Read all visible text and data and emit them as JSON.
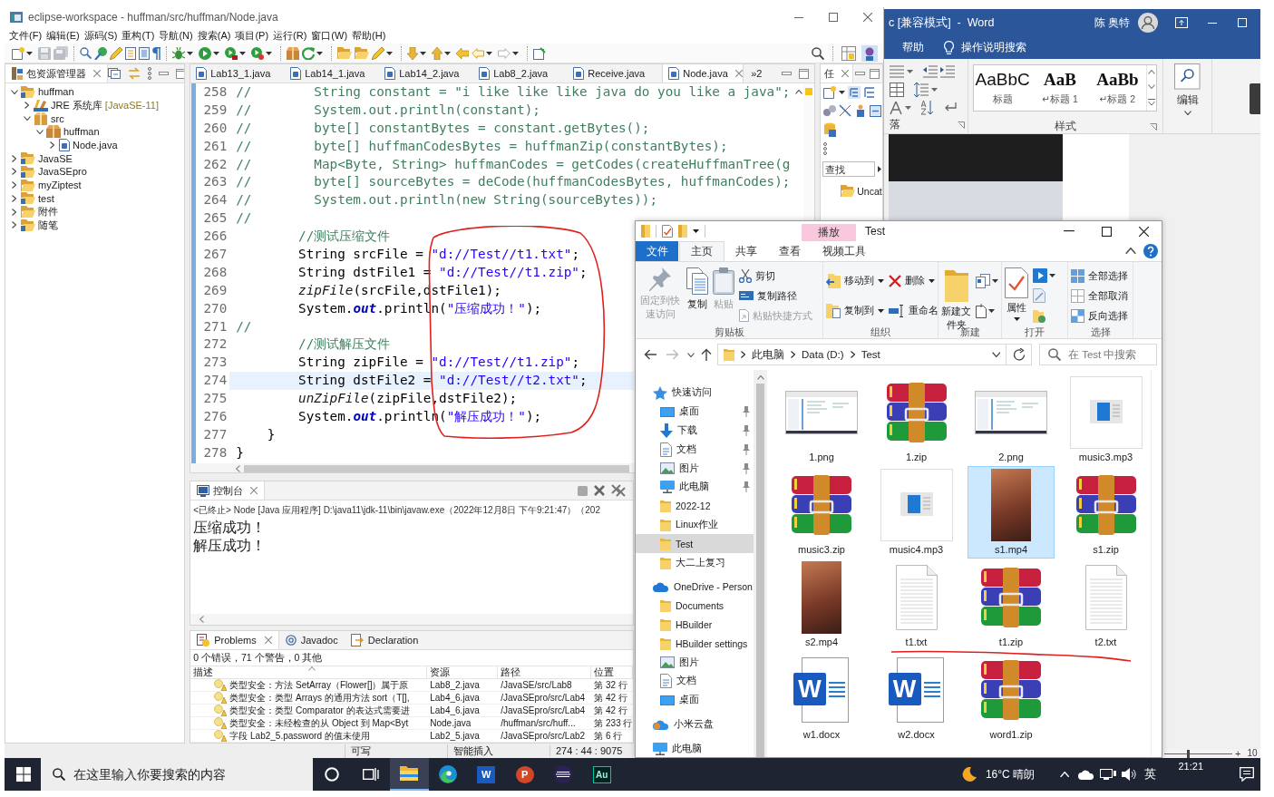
{
  "eclipse": {
    "title": "eclipse-workspace - huffman/src/huffman/Node.java",
    "menu": [
      "文件(F)",
      "编辑(E)",
      "源码(S)",
      "重构(T)",
      "导航(N)",
      "搜索(A)",
      "项目(P)",
      "运行(R)",
      "窗口(W)",
      "帮助(H)"
    ],
    "package_explorer": {
      "title": "包资源管理器",
      "tree": [
        {
          "label": "huffman",
          "kind": "project",
          "expanded": true,
          "children": [
            {
              "label": "JRE 系统库",
              "suffix": "[JavaSE-11]",
              "kind": "library",
              "expanded": false
            },
            {
              "label": "src",
              "kind": "source",
              "expanded": true,
              "children": [
                {
                  "label": "huffman",
                  "kind": "package",
                  "expanded": true,
                  "children": [
                    {
                      "label": "Node.java",
                      "kind": "file",
                      "expanded": false
                    }
                  ]
                }
              ]
            }
          ]
        },
        {
          "label": "JavaSE",
          "kind": "project",
          "expanded": false
        },
        {
          "label": "JavaSEpro",
          "kind": "project",
          "expanded": false
        },
        {
          "label": "myZiptest",
          "kind": "folder",
          "expanded": false
        },
        {
          "label": "test",
          "kind": "project",
          "expanded": false
        },
        {
          "label": "附件",
          "kind": "folder",
          "expanded": false
        },
        {
          "label": "随笔",
          "kind": "project",
          "expanded": false
        }
      ]
    },
    "editor": {
      "tabs": [
        {
          "label": "Lab13_1.java",
          "selected": false
        },
        {
          "label": "Lab14_1.java",
          "selected": false
        },
        {
          "label": "Lab14_2.java",
          "selected": false
        },
        {
          "label": "Lab8_2.java",
          "selected": false
        },
        {
          "label": "Receive.java",
          "selected": false
        },
        {
          "label": "Node.java",
          "selected": true
        }
      ],
      "more": "»2",
      "lines": [
        {
          "number": "258",
          "current": false,
          "tokens": [
            {
              "kind": "comment",
              "text": "//        String constant = \"i like like like java do you like a java\";"
            }
          ]
        },
        {
          "number": "259",
          "current": false,
          "tokens": [
            {
              "kind": "comment",
              "text": "//        System.out.println(constant);"
            }
          ]
        },
        {
          "number": "260",
          "current": false,
          "tokens": [
            {
              "kind": "comment",
              "text": "//        byte[] constantBytes = constant.getBytes();"
            }
          ]
        },
        {
          "number": "261",
          "current": false,
          "tokens": [
            {
              "kind": "comment",
              "text": "//        byte[] huffmanCodesBytes = huffmanZip(constantBytes);"
            }
          ]
        },
        {
          "number": "262",
          "current": false,
          "tokens": [
            {
              "kind": "comment",
              "text": "//        Map<Byte, String> huffmanCodes = getCodes(createHuffmanTree(g"
            }
          ]
        },
        {
          "number": "263",
          "current": false,
          "tokens": [
            {
              "kind": "comment",
              "text": "//        byte[] sourceBytes = deCode(huffmanCodesBytes, huffmanCodes);"
            }
          ]
        },
        {
          "number": "264",
          "current": false,
          "tokens": [
            {
              "kind": "comment",
              "text": "//        System.out.println(new String(sourceBytes));"
            }
          ]
        },
        {
          "number": "265",
          "current": false,
          "tokens": [
            {
              "kind": "comment",
              "text": "//"
            }
          ]
        },
        {
          "number": "266",
          "current": false,
          "tokens": [
            {
              "kind": "comment",
              "text": "        //测试压缩文件"
            }
          ]
        },
        {
          "number": "267",
          "current": false,
          "tokens": [
            {
              "kind": "plain",
              "text": "        String srcFile = "
            },
            {
              "kind": "string",
              "text": "\"d://Test//t1.txt\""
            },
            {
              "kind": "plain",
              "text": ";"
            }
          ]
        },
        {
          "number": "268",
          "current": false,
          "tokens": [
            {
              "kind": "plain",
              "text": "        String dstFile1 = "
            },
            {
              "kind": "string",
              "text": "\"d://Test//t1.zip\""
            },
            {
              "kind": "plain",
              "text": ";"
            }
          ]
        },
        {
          "number": "269",
          "current": false,
          "tokens": [
            {
              "kind": "method",
              "text": "        zipFile"
            },
            {
              "kind": "plain",
              "text": "(srcFile,dstFile1);"
            }
          ]
        },
        {
          "number": "270",
          "current": false,
          "tokens": [
            {
              "kind": "plain",
              "text": "        System."
            },
            {
              "kind": "field",
              "text": "out"
            },
            {
              "kind": "plain",
              "text": ".println("
            },
            {
              "kind": "string",
              "text": "\"压缩成功！\""
            },
            {
              "kind": "plain",
              "text": ");"
            }
          ]
        },
        {
          "number": "271",
          "current": false,
          "tokens": [
            {
              "kind": "comment",
              "text": "//"
            }
          ]
        },
        {
          "number": "272",
          "current": false,
          "tokens": [
            {
              "kind": "comment",
              "text": "        //测试解压文件"
            }
          ]
        },
        {
          "number": "273",
          "current": false,
          "tokens": [
            {
              "kind": "plain",
              "text": "        String zipFile = "
            },
            {
              "kind": "string",
              "text": "\"d://Test//t1.zip\""
            },
            {
              "kind": "plain",
              "text": ";"
            }
          ]
        },
        {
          "number": "274",
          "current": true,
          "tokens": [
            {
              "kind": "plain",
              "text": "        String dstFile2 = "
            },
            {
              "kind": "string",
              "text": "\"d://Test//t2.txt\""
            },
            {
              "kind": "plain",
              "text": ";"
            }
          ]
        },
        {
          "number": "275",
          "current": false,
          "tokens": [
            {
              "kind": "method",
              "text": "        unZipFile"
            },
            {
              "kind": "plain",
              "text": "(zipFile,dstFile2);"
            }
          ]
        },
        {
          "number": "276",
          "current": false,
          "tokens": [
            {
              "kind": "plain",
              "text": "        System."
            },
            {
              "kind": "field",
              "text": "out"
            },
            {
              "kind": "plain",
              "text": ".println("
            },
            {
              "kind": "string",
              "text": "\"解压成功！\""
            },
            {
              "kind": "plain",
              "text": ");"
            }
          ]
        },
        {
          "number": "277",
          "current": false,
          "tokens": [
            {
              "kind": "plain",
              "text": "    }"
            }
          ]
        },
        {
          "number": "278",
          "current": false,
          "tokens": [
            {
              "kind": "plain",
              "text": "}"
            }
          ]
        }
      ]
    },
    "task_pane": {
      "tab": "任",
      "placeholder": "查找",
      "category": "Uncat"
    },
    "console": {
      "title": "控制台",
      "header": "<已终止> Node [Java 应用程序] D:\\java11\\jdk-11\\bin\\javaw.exe（2022年12月8日 下午9:21:47）（202",
      "output": [
        "压缩成功！",
        "解压成功！"
      ]
    },
    "problems": {
      "tabs": [
        {
          "label": "Problems",
          "selected": true
        },
        {
          "label": "Javadoc",
          "selected": false
        },
        {
          "label": "Declaration",
          "selected": false
        }
      ],
      "summary": "0 个错误，71 个警告，0 其他",
      "columns": [
        "描述",
        "资源",
        "路径",
        "位置"
      ],
      "rows": [
        {
          "description": "类型安全：方法 SetArray（Flower[]）属于原",
          "resource": "Lab8_2.java",
          "path": "/JavaSE/src/Lab8",
          "location": "第 32 行"
        },
        {
          "description": "类型安全：类型 Arrays 的通用方法 sort（T[],",
          "resource": "Lab4_6.java",
          "path": "/JavaSEpro/src/Lab4",
          "location": "第 42 行"
        },
        {
          "description": "类型安全：类型 Comparator 的表达式需要进",
          "resource": "Lab4_6.java",
          "path": "/JavaSEpro/src/Lab4",
          "location": "第 42 行"
        },
        {
          "description": "类型安全：未经检查的从 Object 到 Map<Byt",
          "resource": "Node.java",
          "path": "/huffman/src/huff...",
          "location": "第 233 行"
        },
        {
          "description": "字段 Lab2_5.password 的值未使用",
          "resource": "Lab2_5.java",
          "path": "/JavaSEpro/src/Lab2",
          "location": "第 6 行"
        }
      ]
    },
    "status_bar": [
      "可写",
      "智能插入",
      "274 : 44 : 9075"
    ]
  },
  "word": {
    "title": "c [兼容模式]  -  Word",
    "user": "陈 奥特",
    "tabs": [
      "帮助"
    ],
    "tell_me": "操作说明搜索",
    "group_fragment": "落",
    "styles": [
      {
        "sample": "AaBbC",
        "name": "标题",
        "kind": "title"
      },
      {
        "sample": "AaB",
        "name": "↵标题 1",
        "kind": "heading"
      },
      {
        "sample": "AaBb",
        "name": "↵标题 2",
        "kind": "heading"
      }
    ],
    "styles_label": "样式",
    "edit_label": "编辑",
    "zoom": {
      "level": 0.35,
      "plus": "+",
      "value": "10"
    }
  },
  "explorer": {
    "context_tab": "播放",
    "title": "Test",
    "ribbon_tabs": [
      {
        "label": "文件",
        "kind": "backstage",
        "selected": false
      },
      {
        "label": "主页",
        "kind": "tab",
        "selected": true
      },
      {
        "label": "共享",
        "kind": "tab",
        "selected": false
      },
      {
        "label": "查看",
        "kind": "tab",
        "selected": false
      },
      {
        "label": "视频工具",
        "kind": "context",
        "selected": false
      }
    ],
    "ribbon": [
      {
        "label": "剪贴板",
        "commands": [
          {
            "label": "固定到快速访问",
            "kind": "large",
            "disabled": true,
            "dropdown": false
          },
          {
            "label": "复制",
            "kind": "large",
            "disabled": false,
            "dropdown": false
          },
          {
            "label": "粘贴",
            "kind": "large",
            "disabled": true,
            "dropdown": false
          },
          {
            "label": "剪切",
            "kind": "small",
            "disabled": false,
            "dropdown": false
          },
          {
            "label": "复制路径",
            "kind": "small",
            "disabled": false,
            "dropdown": false
          },
          {
            "label": "粘贴快捷方式",
            "kind": "small",
            "disabled": true,
            "dropdown": false
          }
        ]
      },
      {
        "label": "组织",
        "commands": [
          {
            "label": "移动到",
            "kind": "medium",
            "disabled": false,
            "dropdown": true
          },
          {
            "label": "复制到",
            "kind": "medium",
            "disabled": false,
            "dropdown": true
          },
          {
            "label": "删除",
            "kind": "medium",
            "disabled": false,
            "dropdown": true
          },
          {
            "label": "重命名",
            "kind": "medium",
            "disabled": false,
            "dropdown": false
          }
        ]
      },
      {
        "label": "新建",
        "commands": [
          {
            "label": "新建文件夹",
            "kind": "large",
            "disabled": false,
            "dropdown": false
          }
        ]
      },
      {
        "label": "打开",
        "commands": [
          {
            "label": "属性",
            "kind": "large",
            "disabled": false,
            "dropdown": true
          }
        ]
      },
      {
        "label": "选择",
        "commands": [
          {
            "label": "全部选择",
            "kind": "small",
            "disabled": false,
            "dropdown": false
          },
          {
            "label": "全部取消",
            "kind": "small",
            "disabled": false,
            "dropdown": false
          },
          {
            "label": "反向选择",
            "kind": "small",
            "disabled": false,
            "dropdown": false
          }
        ]
      }
    ],
    "address": {
      "crumbs": [
        "此电脑",
        "Data (D:)",
        "Test"
      ],
      "placeholder": "在 Test 中搜索"
    },
    "nav": [
      {
        "label": "快速访问",
        "kind": "quick",
        "pinned": false,
        "selected": false,
        "children": [
          {
            "label": "桌面",
            "kind": "desktop",
            "pinned": true,
            "selected": false
          },
          {
            "label": "下载",
            "kind": "downloads",
            "pinned": true,
            "selected": false
          },
          {
            "label": "文档",
            "kind": "documents",
            "pinned": true,
            "selected": false
          },
          {
            "label": "图片",
            "kind": "pictures",
            "pinned": true,
            "selected": false
          },
          {
            "label": "此电脑",
            "kind": "computer",
            "pinned": true,
            "selected": false
          },
          {
            "label": "2022-12",
            "kind": "folder",
            "pinned": false,
            "selected": false
          },
          {
            "label": "Linux作业",
            "kind": "folder",
            "pinned": false,
            "selected": false
          },
          {
            "label": "Test",
            "kind": "folder",
            "pinned": false,
            "selected": true
          },
          {
            "label": "大二上复习",
            "kind": "folder",
            "pinned": false,
            "selected": false
          }
        ]
      },
      {
        "label": "OneDrive - Person",
        "kind": "onedrive",
        "pinned": false,
        "selected": false,
        "children": [
          {
            "label": "Documents",
            "kind": "folder",
            "pinned": false,
            "selected": false
          },
          {
            "label": "HBuilder",
            "kind": "folder",
            "pinned": false,
            "selected": false
          },
          {
            "label": "HBuilder settings",
            "kind": "folder",
            "pinned": false,
            "selected": false
          },
          {
            "label": "图片",
            "kind": "pictures",
            "pinned": false,
            "selected": false
          },
          {
            "label": "文档",
            "kind": "documents",
            "pinned": false,
            "selected": false
          },
          {
            "label": "桌面",
            "kind": "desktop",
            "pinned": false,
            "selected": false
          }
        ]
      },
      {
        "label": "小米云盘",
        "kind": "micloud",
        "pinned": false,
        "selected": false
      },
      {
        "label": "此电脑",
        "kind": "computer",
        "pinned": false,
        "selected": false
      }
    ],
    "files": [
      {
        "name": "1.png",
        "kind": "png",
        "selected": false
      },
      {
        "name": "1.zip",
        "kind": "zip",
        "selected": false
      },
      {
        "name": "2.png",
        "kind": "png",
        "selected": false
      },
      {
        "name": "music3.mp3",
        "kind": "mp3",
        "selected": false
      },
      {
        "name": "music3.zip",
        "kind": "zip",
        "selected": false
      },
      {
        "name": "music4.mp3",
        "kind": "mp3",
        "selected": false
      },
      {
        "name": "s1.mp4",
        "kind": "mp4",
        "selected": true
      },
      {
        "name": "s1.zip",
        "kind": "zip",
        "selected": false
      },
      {
        "name": "s2.mp4",
        "kind": "mp4",
        "selected": false
      },
      {
        "name": "t1.txt",
        "kind": "txt",
        "selected": false
      },
      {
        "name": "t1.zip",
        "kind": "zip",
        "selected": false
      },
      {
        "name": "t2.txt",
        "kind": "txt",
        "selected": false
      },
      {
        "name": "w1.docx",
        "kind": "docx",
        "icon_text": "W",
        "selected": false
      },
      {
        "name": "w2.docx",
        "kind": "docx",
        "icon_text": "W",
        "selected": false
      },
      {
        "name": "word1.zip",
        "kind": "zip",
        "selected": false
      }
    ]
  },
  "taskbar": {
    "placeholder": "在这里输入你要搜索的内容",
    "apps": [
      {
        "kind": "cortana",
        "active": false
      },
      {
        "kind": "taskview",
        "active": false
      },
      {
        "kind": "explorer",
        "active": true
      },
      {
        "kind": "edge",
        "active": false
      },
      {
        "kind": "word",
        "label": "W",
        "active": false
      },
      {
        "kind": "powerpoint",
        "label": "P",
        "active": false
      },
      {
        "kind": "eclipse",
        "active": false
      },
      {
        "kind": "audition",
        "label": "Au",
        "active": false
      }
    ],
    "weather": "16°C 晴朗",
    "ime": "英",
    "time": "21:21"
  }
}
